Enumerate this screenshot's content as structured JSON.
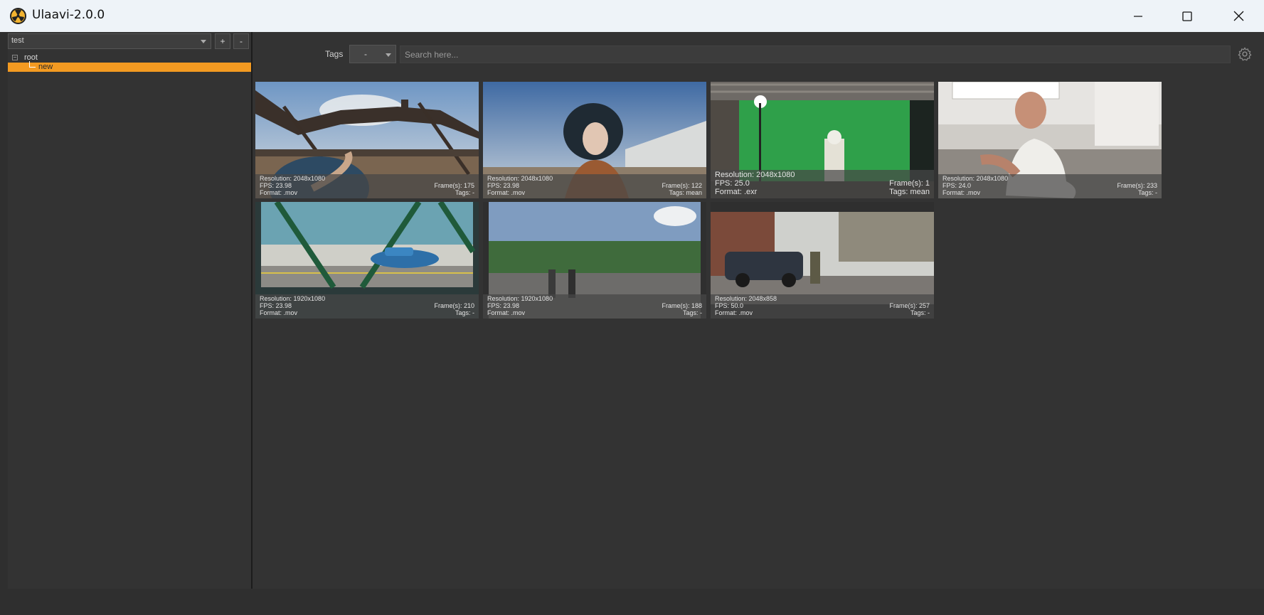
{
  "window": {
    "title": "Ulaavi-2.0.0",
    "min_icon": "minimize-icon",
    "max_icon": "maximize-icon",
    "close_icon": "close-icon"
  },
  "sidebar": {
    "project": "test",
    "add_label": "+",
    "remove_label": "-",
    "tree": {
      "toggle": "−",
      "root": "root",
      "child": "new"
    }
  },
  "toolbar": {
    "tags_label": "Tags",
    "tags_value": "-",
    "search_placeholder": "Search here..."
  },
  "media": [
    {
      "resolution": "Resolution: 2048x1080",
      "fps": "FPS: 23.98",
      "format": "Format: .mov",
      "frames": "Frame(s): 175",
      "tags": "Tags: -"
    },
    {
      "resolution": "Resolution: 2048x1080",
      "fps": "FPS: 23.98",
      "format": "Format: .mov",
      "frames": "Frame(s): 122",
      "tags": "Tags: mean"
    },
    {
      "resolution": "Resolution: 2048x1080",
      "fps": "FPS: 25.0",
      "format": "Format: .exr",
      "frames": "Frame(s): 1",
      "tags": "Tags: mean"
    },
    {
      "resolution": "Resolution: 2048x1080",
      "fps": "FPS: 24.0",
      "format": "Format: .mov",
      "frames": "Frame(s): 233",
      "tags": "Tags: -"
    },
    {
      "resolution": "Resolution: 1920x1080",
      "fps": "FPS: 23.98",
      "format": "Format: .mov",
      "frames": "Frame(s): 210",
      "tags": "Tags: -"
    },
    {
      "resolution": "Resolution: 1920x1080",
      "fps": "FPS: 23.98",
      "format": "Format: .mov",
      "frames": "Frame(s): 188",
      "tags": "Tags: -"
    },
    {
      "resolution": "Resolution: 2048x858",
      "fps": "FPS: 50.0",
      "format": "Format: .mov",
      "frames": "Frame(s): 257",
      "tags": "Tags: -"
    }
  ],
  "colors": {
    "accent": "#f39a21",
    "panel": "#333333",
    "titlebar": "#eef3f8"
  }
}
